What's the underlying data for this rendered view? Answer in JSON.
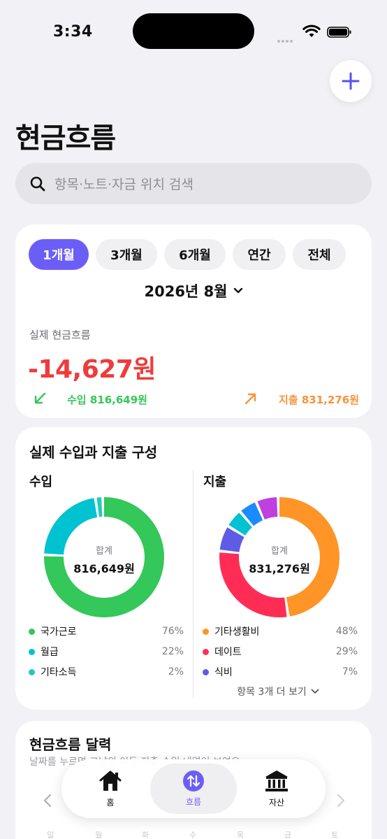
{
  "status": {
    "time": "3:34"
  },
  "page": {
    "title": "현금흐름"
  },
  "search": {
    "placeholder": "항목·노트·자금 위치 검색"
  },
  "period": {
    "tabs": [
      "1개월",
      "3개월",
      "6개월",
      "연간",
      "전체"
    ],
    "active": "1개월",
    "month_label": "2026년 8월"
  },
  "cashflow": {
    "label": "실제 현금흐름",
    "value": "-14,627원",
    "income": "수입 816,649원",
    "expense": "지출 831,276원"
  },
  "composition": {
    "title": "실제 수입과 지출 구성",
    "income": {
      "title": "수입",
      "total_label": "합계",
      "total": "816,649원",
      "items": [
        {
          "name": "국가근로",
          "pct": "76%",
          "value": 76,
          "color": "#34c759"
        },
        {
          "name": "월급",
          "pct": "22%",
          "value": 22,
          "color": "#00c2d1"
        },
        {
          "name": "기타소득",
          "pct": "2%",
          "value": 2,
          "color": "#1fcbb8"
        }
      ]
    },
    "expense": {
      "title": "지출",
      "total_label": "합계",
      "total": "831,276원",
      "items": [
        {
          "name": "기타생활비",
          "pct": "48%",
          "value": 48,
          "color": "#ff9427"
        },
        {
          "name": "데이트",
          "pct": "29%",
          "value": 29,
          "color": "#ff2d55"
        },
        {
          "name": "식비",
          "pct": "7%",
          "value": 7,
          "color": "#5e5ce6"
        }
      ],
      "hidden_segments": [
        {
          "value": 5,
          "color": "#00c2d1"
        },
        {
          "value": 5,
          "color": "#1a8cff"
        },
        {
          "value": 6,
          "color": "#bf3fe0"
        }
      ],
      "more_label": "항목 3개 더 보기"
    }
  },
  "calendar": {
    "title": "현금흐름 달력",
    "subtitle": "날짜를 누르면 그날의 이동·지출·수입 내역이 보여요",
    "weekdays": [
      "일",
      "월",
      "화",
      "수",
      "목",
      "금",
      "토"
    ]
  },
  "tabbar": {
    "items": [
      {
        "label": "홈",
        "icon": "house-icon"
      },
      {
        "label": "흐름",
        "icon": "arrows-up-down-icon",
        "active": true
      },
      {
        "label": "자산",
        "icon": "bank-icon"
      }
    ]
  }
}
